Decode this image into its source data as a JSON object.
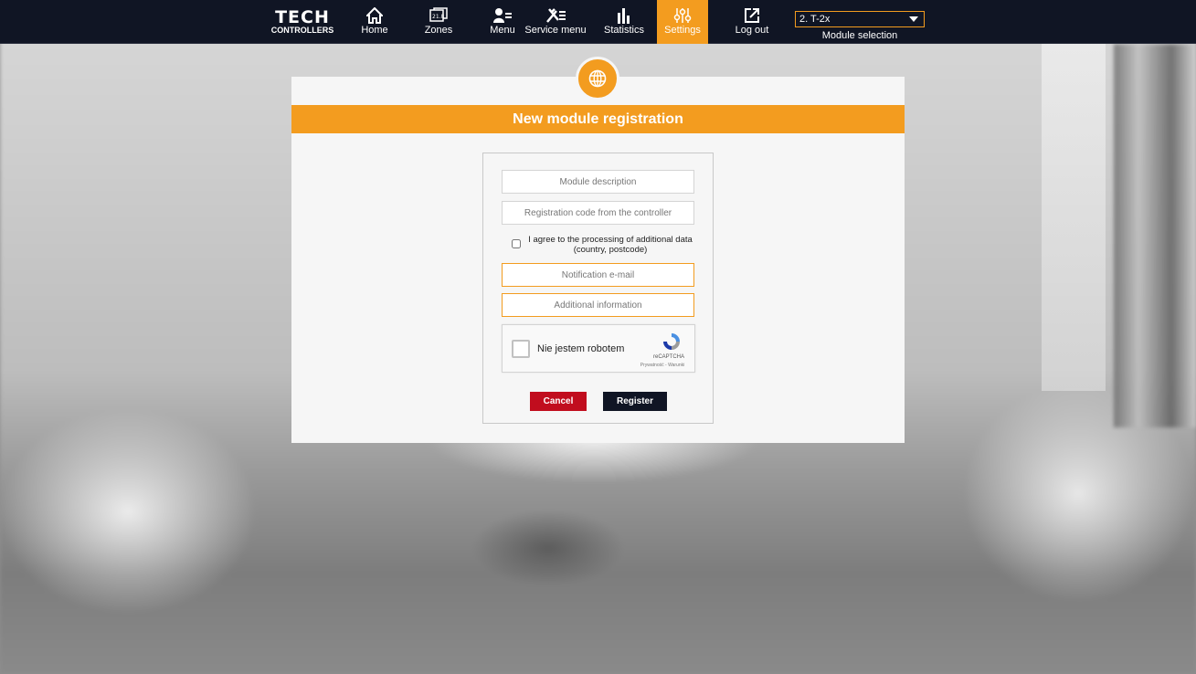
{
  "brand": {
    "name": "TECH",
    "sub": "CONTROLLERS"
  },
  "nav": {
    "home": "Home",
    "zones": "Zones",
    "zones_icon_text": "21.8",
    "menu": "Menu",
    "service_menu": "Service menu",
    "statistics": "Statistics",
    "settings": "Settings",
    "logout": "Log out",
    "active": "settings"
  },
  "module_selection": {
    "value": "2. T-2x",
    "label": "Module selection"
  },
  "panel": {
    "title": "New module registration",
    "icon": "globe-icon"
  },
  "form": {
    "module_description_placeholder": "Module description",
    "registration_code_placeholder": "Registration code from the controller",
    "consent_text": "I agree to the processing of additional data (country, postcode)",
    "notification_email_placeholder": "Notification e-mail",
    "additional_info_placeholder": "Additional information"
  },
  "captcha": {
    "label": "Nie jestem robotem",
    "brand": "reCAPTCHA",
    "links": "Prywatność - Warunki"
  },
  "buttons": {
    "cancel": "Cancel",
    "register": "Register"
  },
  "colors": {
    "accent": "#f39c1f",
    "navbar": "#101524",
    "cancel": "#c10d1e"
  }
}
